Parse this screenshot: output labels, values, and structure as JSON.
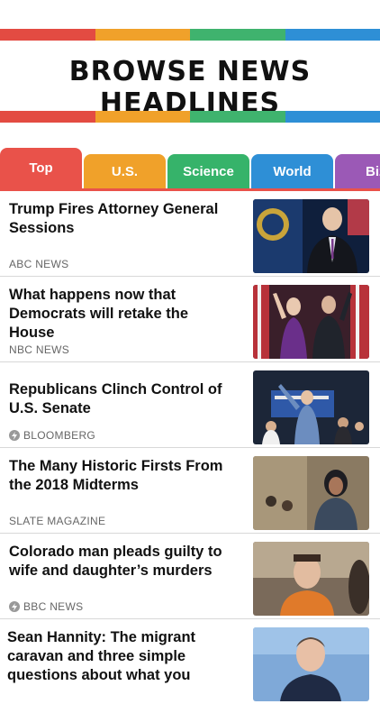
{
  "header": {
    "title": "BROWSE NEWS HEADLINES",
    "stripe_colors": [
      "#e34b42",
      "#f0a12a",
      "#3fb36e",
      "#2e8fd6"
    ]
  },
  "tabs": [
    {
      "label": "Top",
      "color": "#e9524a",
      "active": true
    },
    {
      "label": "U.S.",
      "color": "#f0a12a",
      "active": false
    },
    {
      "label": "Science",
      "color": "#36b36a",
      "active": false
    },
    {
      "label": "World",
      "color": "#2e8fd6",
      "active": false
    },
    {
      "label": "Biz",
      "color": "#9b59b6",
      "active": false
    }
  ],
  "stories": [
    {
      "headline": "Trump Fires Attorney General Sessions",
      "source": "ABC NEWS",
      "lightning": false,
      "image": "person-at-podium-photo"
    },
    {
      "headline": "What happens now that Democrats will retake the House",
      "source": "NBC NEWS",
      "lightning": false,
      "image": "politicians-celebrating-photo"
    },
    {
      "headline": "Republicans Clinch Control of U.S. Senate",
      "source": "BLOOMBERG",
      "lightning": true,
      "image": "rally-crowd-photo"
    },
    {
      "headline": "The Many Historic Firsts From the 2018 Midterms",
      "source": "SLATE MAGAZINE",
      "lightning": false,
      "image": "candidate-portrait-photo"
    },
    {
      "headline": "Colorado man pleads guilty to wife and daughter’s murders",
      "source": "BBC NEWS",
      "lightning": true,
      "image": "courtroom-photo"
    },
    {
      "headline": "Sean Hannity: The migrant caravan and three simple questions about what you",
      "source": "",
      "lightning": false,
      "image": "tv-host-photo"
    }
  ]
}
